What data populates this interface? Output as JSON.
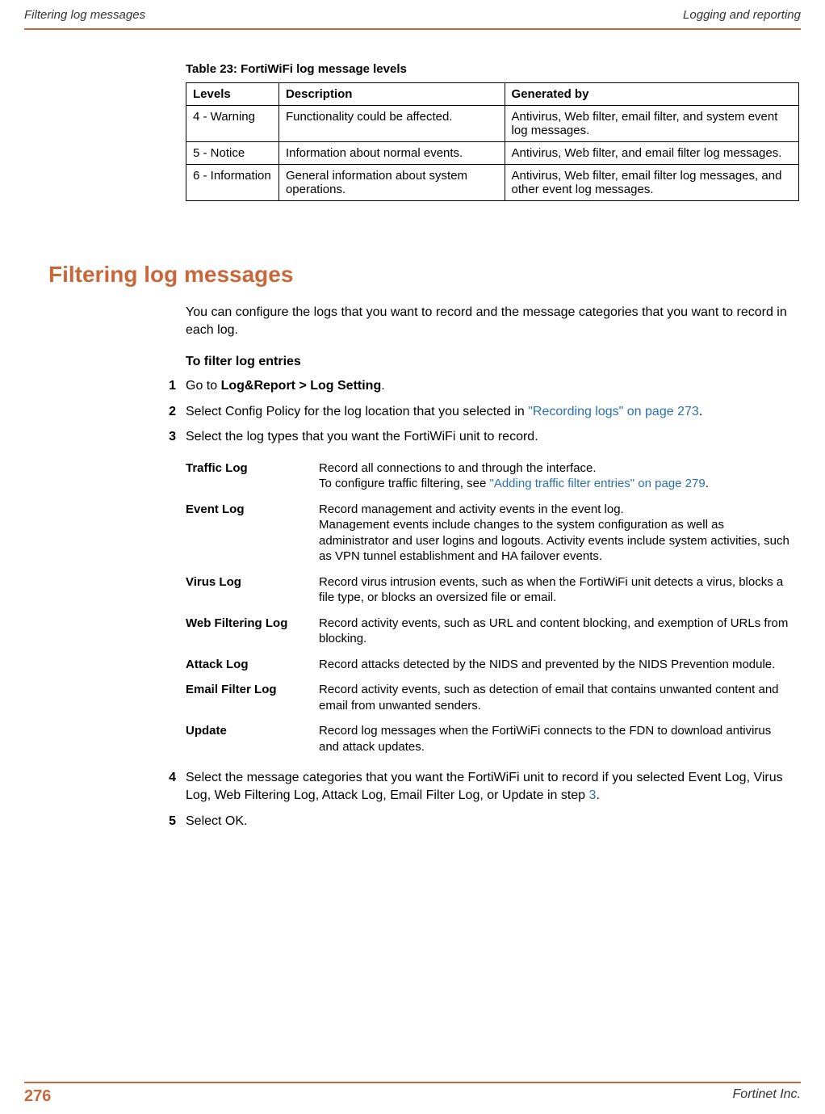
{
  "header": {
    "left": "Filtering log messages",
    "right": "Logging and reporting"
  },
  "table23": {
    "caption": "Table 23: FortiWiFi log message levels",
    "headers": [
      "Levels",
      "Description",
      "Generated by"
    ],
    "rows": [
      {
        "level": "4 - Warning",
        "desc": "Functionality could be affected.",
        "gen": "Antivirus, Web filter, email filter, and system event log messages."
      },
      {
        "level": "5 - Notice",
        "desc": "Information about normal events.",
        "gen": "Antivirus, Web filter, and email filter log messages."
      },
      {
        "level": "6 - Information",
        "desc": "General information about system operations.",
        "gen": "Antivirus, Web filter, email filter log messages, and other event log messages."
      }
    ]
  },
  "section": {
    "title": "Filtering log messages",
    "intro": "You can configure the logs that you want to record and the message categories that you want to record in each log.",
    "subhead": "To filter log entries",
    "steps": {
      "s1": {
        "num": "1",
        "prefix": "Go to ",
        "bold": "Log&Report > Log Setting",
        "suffix": "."
      },
      "s2": {
        "num": "2",
        "prefix": "Select Config Policy for the log location that you selected in ",
        "link": "\"Recording logs\" on page 273",
        "suffix": "."
      },
      "s3": {
        "num": "3",
        "text": "Select the log types that you want the FortiWiFi unit to record."
      },
      "s4": {
        "num": "4",
        "prefix": "Select the message categories that you want the FortiWiFi unit to record if you selected Event Log, Virus Log, Web Filtering Log, Attack Log, Email Filter Log, or Update in step ",
        "link": "3",
        "suffix": "."
      },
      "s5": {
        "num": "5",
        "text": "Select OK."
      }
    }
  },
  "logtypes": [
    {
      "name": "Traffic Log",
      "desc_before": "Record all connections to and through the interface.\nTo configure traffic filtering, see ",
      "link": "\"Adding traffic filter entries\" on page 279",
      "desc_after": "."
    },
    {
      "name": "Event Log",
      "desc": "Record management and activity events in the event log.\nManagement events include changes to the system configuration as well as administrator and user logins and logouts. Activity events include system activities, such as VPN tunnel establishment and HA failover events."
    },
    {
      "name": "Virus Log",
      "desc": "Record virus intrusion events, such as when the FortiWiFi unit detects a virus, blocks a file type, or blocks an oversized file or email."
    },
    {
      "name": "Web Filtering Log",
      "desc": "Record activity events, such as URL and content blocking, and exemption of URLs from blocking."
    },
    {
      "name": "Attack Log",
      "desc": "Record attacks detected by the NIDS and prevented by the NIDS Prevention module."
    },
    {
      "name": "Email Filter Log",
      "desc": "Record activity events, such as detection of email that contains unwanted content and email from unwanted senders."
    },
    {
      "name": "Update",
      "desc": "Record log messages when the FortiWiFi connects to the FDN to download antivirus and attack updates."
    }
  ],
  "footer": {
    "page": "276",
    "company": "Fortinet Inc."
  }
}
